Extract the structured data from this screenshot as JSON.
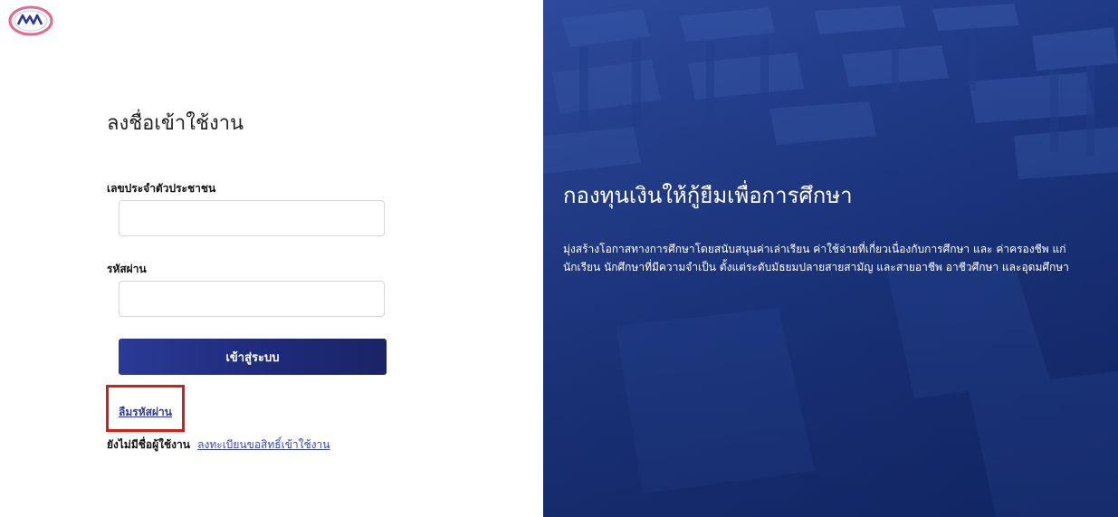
{
  "logo": {
    "icon": "kyslf-logo-icon",
    "text": "กยศ"
  },
  "login": {
    "title": "ลงชื่อเข้าใช้งาน",
    "id_label": "เลขประจำตัวประชาชน",
    "id_value": "",
    "password_label": "รหัสผ่าน",
    "password_value": "",
    "submit_label": "เข้าสู่ระบบ",
    "forgot_password_link": "ลืมรหัสผ่าน",
    "no_account_text": "ยังไม่มีชื่อผู้ใช้งาน",
    "register_link": "ลงทะเบียนขอสิทธิ์เข้าใช้งาน"
  },
  "hero": {
    "title": "กองทุนเงินให้กู้ยืมเพื่อการศึกษา",
    "description": "มุ่งสร้างโอกาสทางการศึกษาโดยสนับสนุนค่าเล่าเรียน ค่าใช้จ่ายที่เกี่ยวเนื่องกับการศึกษา และ ค่าครองชีพ แก่นักเรียน นักศึกษาที่มีความจำเป็น ตั้งแต่ระดับมัธยมปลายสายสามัญ และสายอาชีพ อาชีวศึกษา และอุดมศึกษา"
  },
  "colors": {
    "primary": "#1e2a78",
    "link": "#2f3a93",
    "highlight": "#e01818",
    "hero_bg": "#1f3a86"
  }
}
